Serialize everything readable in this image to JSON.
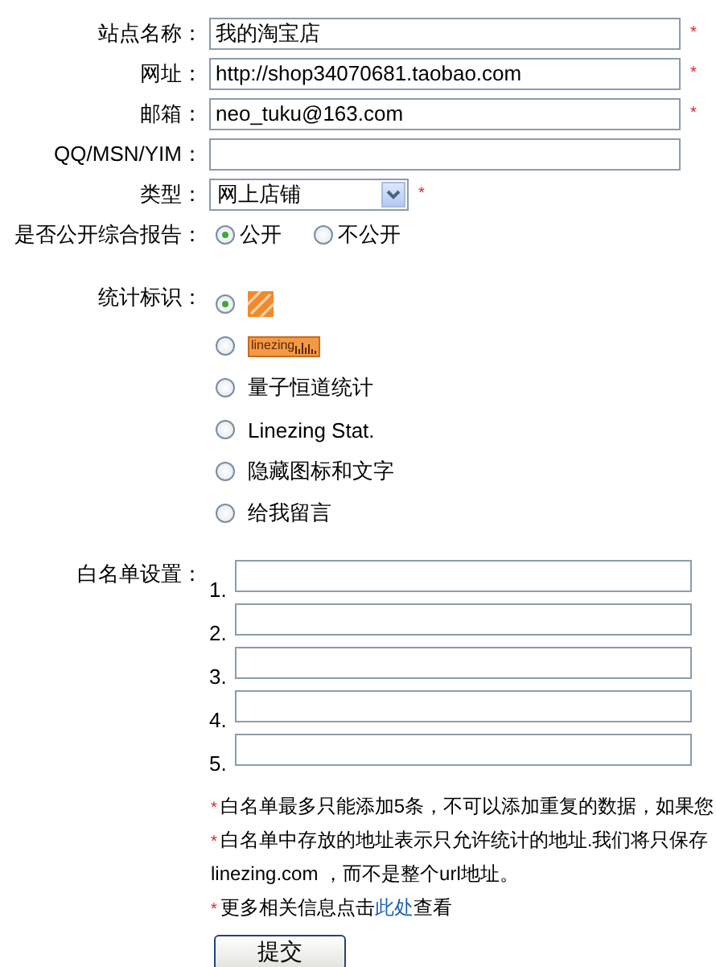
{
  "fields": [
    {
      "label": "站点名称：",
      "kind": "text",
      "value": "我的淘宝店",
      "required": true
    },
    {
      "label": "网址：",
      "kind": "text",
      "value": "http://shop34070681.taobao.com",
      "required": true
    },
    {
      "label": "邮箱：",
      "kind": "text",
      "value": "neo_tuku@163.com",
      "required": true
    },
    {
      "label": "QQ/MSN/YIM：",
      "kind": "text",
      "required": false
    },
    {
      "label": "类型：",
      "kind": "select",
      "value": "网上店铺",
      "required": true
    }
  ],
  "public_report": {
    "label": "是否公开综合报告：",
    "options": [
      {
        "label": "公开",
        "selected": true
      },
      {
        "label": "不公开",
        "selected": false
      }
    ]
  },
  "stat_mark": {
    "label": "统计标识：",
    "options": [
      {
        "kind": "icon",
        "selected": true
      },
      {
        "kind": "badge",
        "label": "linezing",
        "selected": false
      },
      {
        "kind": "text",
        "label": "量子恒道统计",
        "selected": false
      },
      {
        "kind": "text",
        "label": "Linezing Stat.",
        "selected": false
      },
      {
        "kind": "text",
        "label": "隐藏图标和文字",
        "selected": false
      },
      {
        "kind": "text",
        "label": "给我留言",
        "selected": false
      }
    ]
  },
  "whitelist": {
    "label": "白名单设置：",
    "entries": [
      {
        "number": "1."
      },
      {
        "number": "2."
      },
      {
        "number": "3."
      },
      {
        "number": "4."
      },
      {
        "number": "5."
      }
    ]
  },
  "notes": [
    {
      "mark": "*",
      "text": "白名单最多只能添加5条，不可以添加重复的数据，如果您"
    },
    {
      "mark": "*",
      "text": "白名单中存放的地址表示只允许统计的地址.我们将只保存"
    },
    {
      "text": "linezing.com ，而不是整个url地址。"
    },
    {
      "mark": "*",
      "text": "更多相关信息点击",
      "link": "此处",
      "after": "查看"
    }
  ],
  "submit": "提交"
}
